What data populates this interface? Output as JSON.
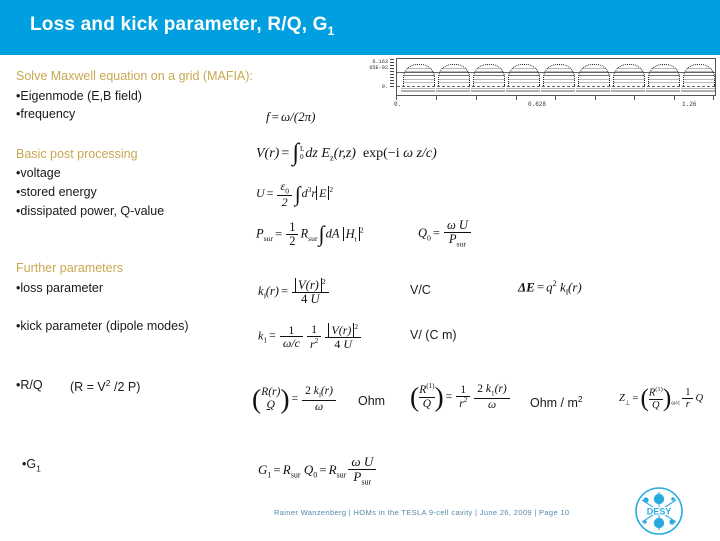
{
  "header": {
    "title_main": "Loss and kick parameter, R/Q, G",
    "title_sub": "1"
  },
  "sections": [
    {
      "heading": "Solve Maxwell equation on a grid (MAFIA):",
      "bullets": [
        "•Eigenmode (E,B field)",
        "•frequency"
      ]
    },
    {
      "heading": "Basic post processing",
      "bullets": [
        "•voltage",
        "•stored energy",
        "•dissipated power, Q-value"
      ]
    },
    {
      "heading": "Further parameters",
      "bullets": [
        "•loss parameter",
        "•kick parameter (dipole modes)"
      ]
    }
  ],
  "rows": {
    "rq_label": "•R/Q",
    "rq_note_a": "(R = V",
    "rq_note_sup": "2",
    "rq_note_b": " /2 P)",
    "g1_label": "•G",
    "g1_sub": "1"
  },
  "units": {
    "loss": "V/C",
    "kick": "V/ (C m)",
    "rq": "Ohm",
    "rq1_a": "Ohm / m",
    "rq1_sup": "2"
  },
  "formulas": {
    "frequency": {
      "lhs": "f",
      "eq": "=",
      "rhs_a": "ω",
      "rhs_b": "/(2",
      "rhs_pi": "π",
      "rhs_c": ")"
    },
    "voltage": {
      "lhs": "V(r)",
      "eq": "=",
      "int_hi": "L",
      "int_lo": "0",
      "dz": "dz",
      "ez": "E",
      "ez_sub": "z",
      "ez_arg": "(r,z)",
      "exp": "exp(−i",
      "omega": "ω",
      "zc": "z/c)"
    },
    "energy": {
      "lhs": "U",
      "eq": "=",
      "eps_num": "ε",
      "eps_num_sub": "0",
      "den": "2",
      "d3r": "d",
      "d3r_sup": "3",
      "d3r_b": "r",
      "field": "E",
      "field_sup": "2"
    },
    "power": {
      "lhs": "P",
      "lhs_sub": "sur",
      "eq": "=",
      "num": "1",
      "den": "2",
      "rsur": "R",
      "rsur_sub": "sur",
      "dA": "dA",
      "h": "H",
      "h_sub": "t",
      "h_sup": "2"
    },
    "qfactor": {
      "lhs": "Q",
      "lhs_sub": "0",
      "eq": "=",
      "num_omega": "ω",
      "num_u": "U",
      "den": "P",
      "den_sub": "sur"
    },
    "loss_parameter": {
      "lhs": "k",
      "lhs_sub": "‖",
      "lhs_arg": "(r)",
      "eq": "=",
      "num": "V(r)",
      "num_sup": "2",
      "den_a": "4",
      "den_b": "U"
    },
    "delta_e": {
      "lhs": "ΔE",
      "eq": "=",
      "q": "q",
      "q_sup": "2",
      "k": "k",
      "k_sub": "‖",
      "k_arg": "(r)"
    },
    "kick_parameter": {
      "lhs": "k",
      "lhs_sub": "1",
      "eq": "=",
      "f1_num": "1",
      "f1_den_a": "ω",
      "f1_den_b": "/c",
      "f2_num": "1",
      "f2_den": "r",
      "f2_den_sup": "2",
      "f3_num": "V(r)",
      "f3_num_sup": "2",
      "f3_den_a": "4",
      "f3_den_b": "U"
    },
    "rq_monopole": {
      "top": "R(r)",
      "bot": "Q",
      "eq": "=",
      "num_a": "2",
      "num_k": "k",
      "num_k_sub": "‖",
      "num_k_arg": "(r)",
      "den": "ω"
    },
    "rq_dipole": {
      "top": "R",
      "top_sup": "(1)",
      "bot": "Q",
      "eq": "=",
      "f1_num": "1",
      "f1_den": "r",
      "f1_den_sup": "2",
      "f2_num_a": "2",
      "f2_num_k": "k",
      "f2_num_k_sub": "1",
      "f2_num_k_arg": "(r)",
      "f2_den": "ω"
    },
    "z_perp": {
      "lhs": "Z",
      "lhs_sub": "⊥",
      "eq": "=",
      "top": "R",
      "top_sup": "(1)",
      "bot": "Q",
      "paren_sub": "ω/c",
      "f_num": "1",
      "f_den": "r",
      "q": "Q"
    },
    "g1": {
      "lhs": "G",
      "lhs_sub": "1",
      "eq1": "=",
      "rsur1": "R",
      "rsur1_sub": "sur",
      "q0": "Q",
      "q0_sub": "0",
      "eq2": "=",
      "rsur2": "R",
      "rsur2_sub": "sur",
      "num_omega": "ω",
      "num_u": "U",
      "den": "P",
      "den_sub": "sur"
    }
  },
  "chart_data": {
    "type": "line",
    "title": "",
    "xlabel": "",
    "ylabel": "",
    "y_ticklabels": [
      "6.163",
      "65E-02",
      "0."
    ],
    "x_ticklabels": [
      "0.",
      "0.628",
      "1.26"
    ],
    "xlim": [
      0.0,
      1.26
    ],
    "ylim": [
      0.0,
      0.0616365
    ],
    "n_cells": 9,
    "description": "electric field magnitude contour plot along a 9-cell TESLA cavity",
    "grid": false,
    "legend": false,
    "series": [
      {
        "name": "cell field lobes",
        "x": [
          0.07,
          0.2,
          0.33,
          0.46,
          0.6,
          0.73,
          0.86,
          0.99,
          1.12
        ],
        "values": [
          0.0616,
          0.0616,
          0.0616,
          0.0616,
          0.0616,
          0.0616,
          0.0616,
          0.0616,
          0.0616
        ]
      }
    ]
  },
  "footer": {
    "text": "Rainer Wanzenberg  |  HOMs in the TESLA 9-cell cavity  |  June 26, 2009  |  Page 10",
    "logo_text": "DESY"
  }
}
